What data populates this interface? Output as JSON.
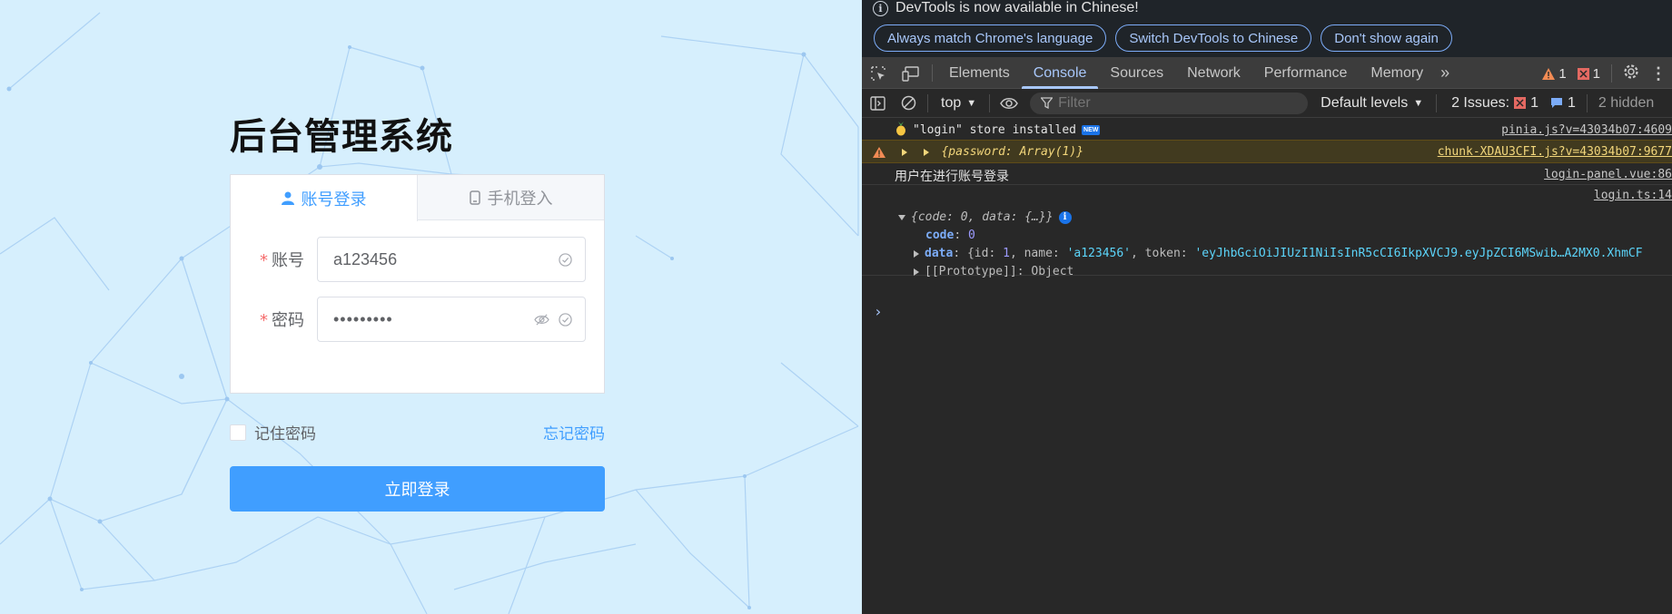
{
  "login": {
    "title": "后台管理系统",
    "tabs": [
      {
        "label": "账号登录",
        "active": true,
        "icon": "user-icon"
      },
      {
        "label": "手机登入",
        "active": false,
        "icon": "phone-icon"
      }
    ],
    "account": {
      "required_mark": "*",
      "label": "账号",
      "value": "a123456"
    },
    "password": {
      "required_mark": "*",
      "label": "密码",
      "value": "•••••••••"
    },
    "remember_label": "记住密码",
    "forgot_label": "忘记密码",
    "submit_label": "立即登录",
    "colors": {
      "primary": "#409eff",
      "background": "#d6effd",
      "required": "#f56c6c"
    }
  },
  "devtools": {
    "notice": {
      "text": "DevTools is now available in Chinese!",
      "buttons": [
        "Always match Chrome's language",
        "Switch DevTools to Chinese",
        "Don't show again"
      ]
    },
    "tabs": [
      "Elements",
      "Console",
      "Sources",
      "Network",
      "Performance",
      "Memory"
    ],
    "active_tab": "Console",
    "warn_count": "1",
    "error_count": "1",
    "toolbar": {
      "context": "top",
      "filter_placeholder": "Filter",
      "levels": "Default levels",
      "issues_label": "2 Issues:",
      "issues_error": "1",
      "issues_info": "1",
      "hidden": "2 hidden"
    },
    "console": {
      "msg1_text": "\"login\" store installed",
      "msg1_badge": "NEW",
      "msg1_src": "pinia.js?v=43034b07:4609",
      "msg2_text": "{password: Array(1)}",
      "msg2_src": "chunk-XDAU3CFI.js?v=43034b07:9677",
      "msg3_text": "用户在进行账号登录",
      "msg3_src": "login-panel.vue:86",
      "msg4_src": "login.ts:14",
      "obj_summary": "{code: 0, data: {…}}",
      "code_key": "code",
      "code_val": "0",
      "data_key": "data",
      "data_open": "{id: ",
      "data_id": "1",
      "data_name_key": ", name: ",
      "data_name": "'a123456'",
      "data_token_key": ", token: ",
      "data_token": "'eyJhbGciOiJIUzI1NiIsInR5cCI6IkpXVCJ9.eyJpZCI6MSwib…A2MX0.XhmCF",
      "proto_label": "[[Prototype]]: Object",
      "prompt": "›"
    },
    "colors": {
      "panel_bg": "#282828",
      "accent": "#a8c7fa",
      "warn_bg": "#413a1f",
      "string": "#5cd5fb",
      "key": "#c58af9"
    }
  }
}
